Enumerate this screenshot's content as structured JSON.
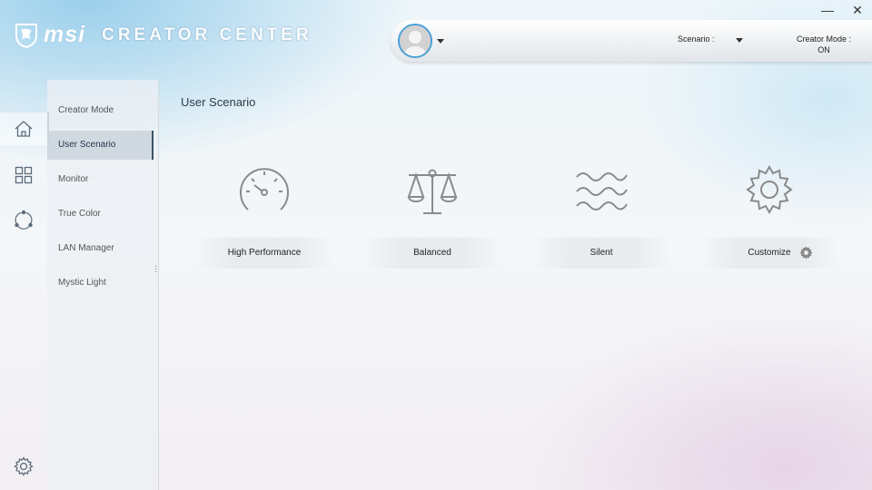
{
  "app": {
    "brand": "msi",
    "product": "CREATOR CENTER"
  },
  "header": {
    "scenario_label": "Scenario :",
    "creator_mode_label": "Creator Mode :",
    "creator_mode_value": "ON",
    "minimize_glyph": "—",
    "close_glyph": "✕"
  },
  "rail": [
    {
      "icon": "home-icon",
      "active": true
    },
    {
      "icon": "apps-grid-icon",
      "active": false
    },
    {
      "icon": "network-share-icon",
      "active": false
    },
    {
      "icon": "settings-gear-icon",
      "active": false
    }
  ],
  "submenu": {
    "items": [
      {
        "label": "Creator Mode"
      },
      {
        "label": "User Scenario",
        "active": true
      },
      {
        "label": "Monitor"
      },
      {
        "label": "True Color"
      },
      {
        "label": "LAN Manager"
      },
      {
        "label": "Mystic Light"
      }
    ]
  },
  "main": {
    "title": "User Scenario",
    "cards": [
      {
        "label": "High Performance",
        "icon": "speedometer-icon"
      },
      {
        "label": "Balanced",
        "icon": "scale-icon"
      },
      {
        "label": "Silent",
        "icon": "waves-icon"
      },
      {
        "label": "Customize",
        "icon": "gear-icon"
      }
    ]
  },
  "colors": {
    "accent": "#4aa0d6",
    "icon_gray": "#8a8a8a",
    "active_border": "#3b5366"
  }
}
